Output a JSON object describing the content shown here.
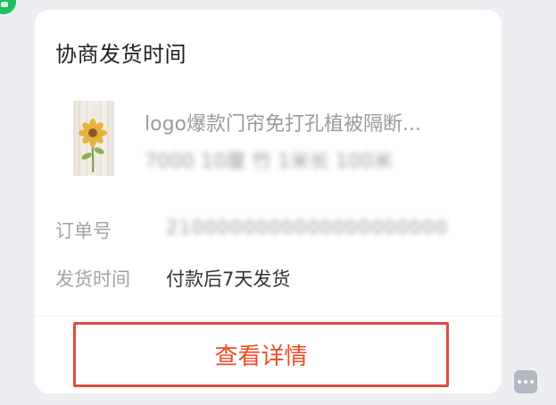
{
  "card": {
    "title": "协商发货时间",
    "product": {
      "name": "logo爆款门帘免打孔植被隔断...",
      "spec": "7000 10厘 竹 1米长 100米"
    },
    "order": {
      "label": "订单号",
      "value": "2100000000000000000000"
    },
    "shipping": {
      "label": "发货时间",
      "value": "付款后7天发货"
    },
    "action_label": "查看详情"
  },
  "colors": {
    "action_border": "#e04a44",
    "action_text": "#ee4a23",
    "avatar": "#1fbf5e",
    "background": "#eceef2"
  },
  "icons": {
    "avatar": "avatar-icon",
    "more": "more-icon",
    "product": "product-thumbnail"
  }
}
